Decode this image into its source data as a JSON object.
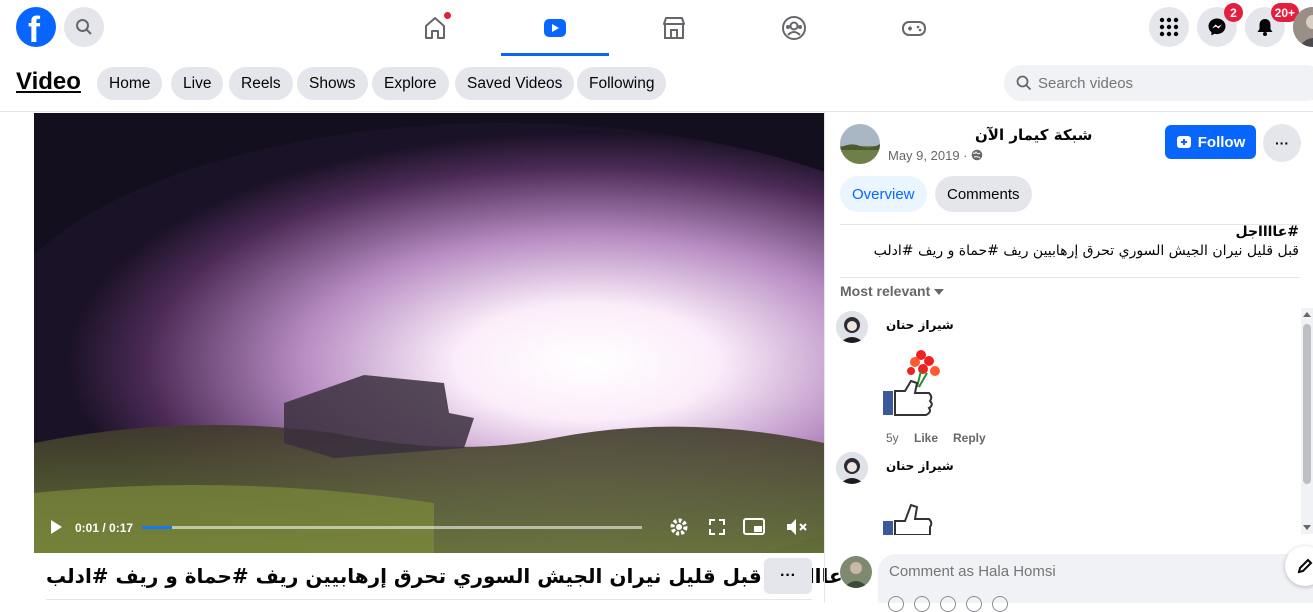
{
  "topbar": {
    "logo_letter": "f",
    "nav": [
      "home-icon",
      "video-icon",
      "marketplace-icon",
      "groups-icon",
      "gaming-icon"
    ],
    "active_nav": "video-icon",
    "messenger_badge": "2",
    "notifications_badge": "20+"
  },
  "subbar": {
    "title": "Video",
    "pills": [
      "Home",
      "Live",
      "Reels",
      "Shows",
      "Explore",
      "Saved Videos",
      "Following"
    ],
    "search_placeholder": "Search videos"
  },
  "video": {
    "time": "0:01 / 0:17",
    "progress": 0.06,
    "caption": "#عااااجل قبل قليل نيران الجيش السوري تحرق إرهابيين ريف #حماة و ريف #ادلب",
    "more_label": "···"
  },
  "post": {
    "author": "شبكة كيمار الآن",
    "date": "May 9, 2019 ·",
    "follow_label": "Follow",
    "options_label": "···",
    "tabs": [
      "Overview",
      "Comments"
    ],
    "desc_line1": "#عااااجل",
    "desc_line2": "قبل قليل نيران الجيش السوري تحرق إرهابيين ريف #حماة و ريف #ادلب",
    "sort_label": "Most relevant"
  },
  "comments": [
    {
      "name": "شيراز حنان",
      "age": "5y",
      "like": "Like",
      "reply": "Reply"
    },
    {
      "name": "شيراز حنان"
    }
  ],
  "compose": {
    "placeholder": "Comment as Hala Homsi"
  },
  "colors": {
    "brand": "#0866ff",
    "badge": "#e41e3f",
    "chip": "#e4e6eb"
  }
}
